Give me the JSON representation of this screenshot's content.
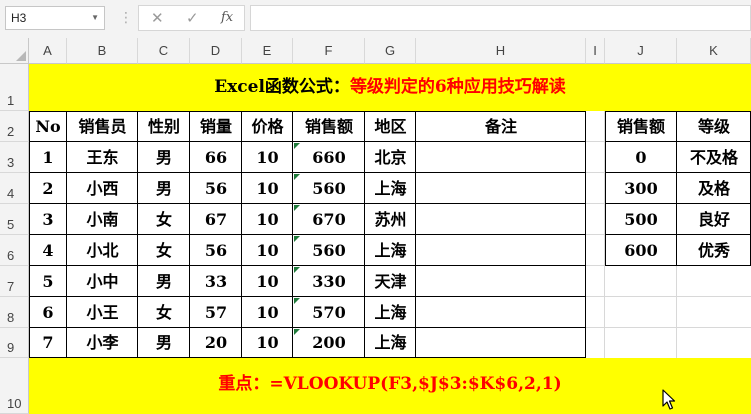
{
  "formula_bar": {
    "name_box": "H3",
    "fx_label": "fx",
    "formula": ""
  },
  "columns": [
    "A",
    "B",
    "C",
    "D",
    "E",
    "F",
    "G",
    "H",
    "I",
    "J",
    "K"
  ],
  "rows": [
    "1",
    "2",
    "3",
    "4",
    "5",
    "6",
    "7",
    "8",
    "9",
    "10"
  ],
  "title": {
    "part1": "Excel函数公式：",
    "part2": "等级判定的6种应用技巧解读"
  },
  "main_table": {
    "headers": [
      "No",
      "销售员",
      "性别",
      "销量",
      "价格",
      "销售额",
      "地区",
      "备注"
    ],
    "rows": [
      [
        "1",
        "王东",
        "男",
        "66",
        "10",
        "660",
        "北京",
        ""
      ],
      [
        "2",
        "小西",
        "男",
        "56",
        "10",
        "560",
        "上海",
        ""
      ],
      [
        "3",
        "小南",
        "女",
        "67",
        "10",
        "670",
        "苏州",
        ""
      ],
      [
        "4",
        "小北",
        "女",
        "56",
        "10",
        "560",
        "上海",
        ""
      ],
      [
        "5",
        "小中",
        "男",
        "33",
        "10",
        "330",
        "天津",
        ""
      ],
      [
        "6",
        "小王",
        "女",
        "57",
        "10",
        "570",
        "上海",
        ""
      ],
      [
        "7",
        "小李",
        "男",
        "20",
        "10",
        "200",
        "上海",
        ""
      ]
    ]
  },
  "grade_table": {
    "headers": [
      "销售额",
      "等级"
    ],
    "rows": [
      [
        "0",
        "不及格"
      ],
      [
        "300",
        "及格"
      ],
      [
        "500",
        "良好"
      ],
      [
        "600",
        "优秀"
      ]
    ]
  },
  "bottom_note": "重点：=VLOOKUP(F3,$J$3:$K$6,2,1)",
  "colors": {
    "highlight": "#ffff00",
    "title_red": "#ff0000",
    "marker_green": "#1f7a3a"
  }
}
